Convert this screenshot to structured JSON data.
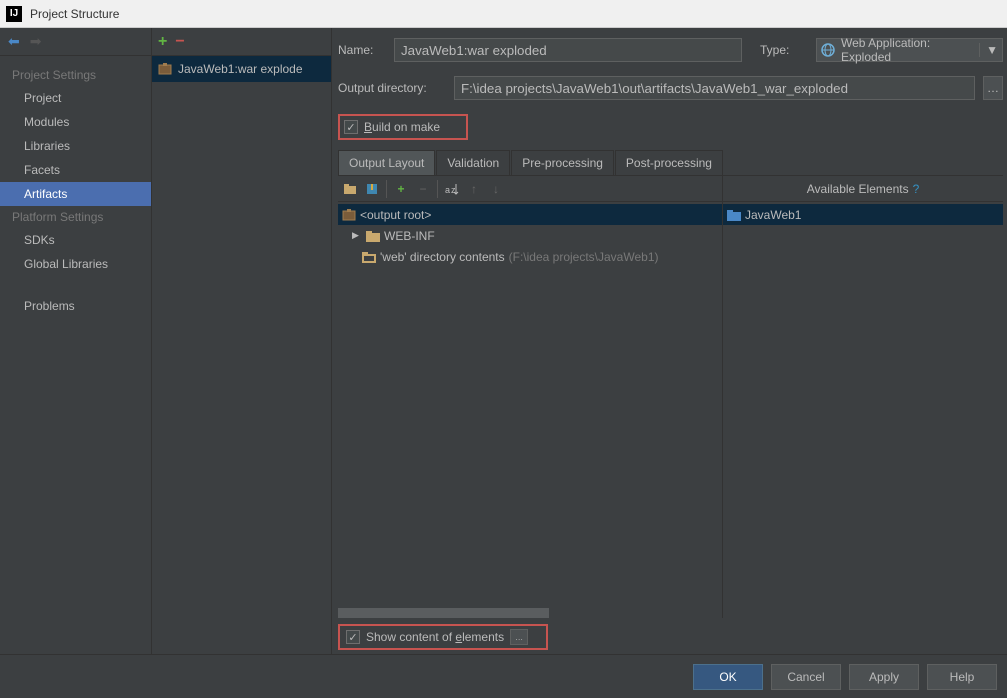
{
  "window": {
    "title": "Project Structure"
  },
  "sidebar": {
    "section1": "Project Settings",
    "items1": [
      "Project",
      "Modules",
      "Libraries",
      "Facets",
      "Artifacts"
    ],
    "section2": "Platform Settings",
    "items2": [
      "SDKs",
      "Global Libraries"
    ],
    "problems": "Problems"
  },
  "artifact_list": {
    "item": "JavaWeb1:war explode"
  },
  "form": {
    "name_label": "Name:",
    "name_value": "JavaWeb1:war exploded",
    "type_label": "Type:",
    "type_value": "Web Application: Exploded",
    "outdir_label": "Output directory:",
    "outdir_value": "F:\\idea projects\\JavaWeb1\\out\\artifacts\\JavaWeb1_war_exploded",
    "build_on_make": "Build on make"
  },
  "tabs": [
    "Output Layout",
    "Validation",
    "Pre-processing",
    "Post-processing"
  ],
  "layout": {
    "available_header": "Available Elements",
    "output_root": "<output root>",
    "webinf": "WEB-INF",
    "webdir": "'web' directory contents",
    "webdir_path": "(F:\\idea projects\\JavaWeb1)",
    "avail_item": "JavaWeb1"
  },
  "show_content": "Show content of elements",
  "buttons": {
    "ok": "OK",
    "cancel": "Cancel",
    "apply": "Apply",
    "help": "Help"
  }
}
